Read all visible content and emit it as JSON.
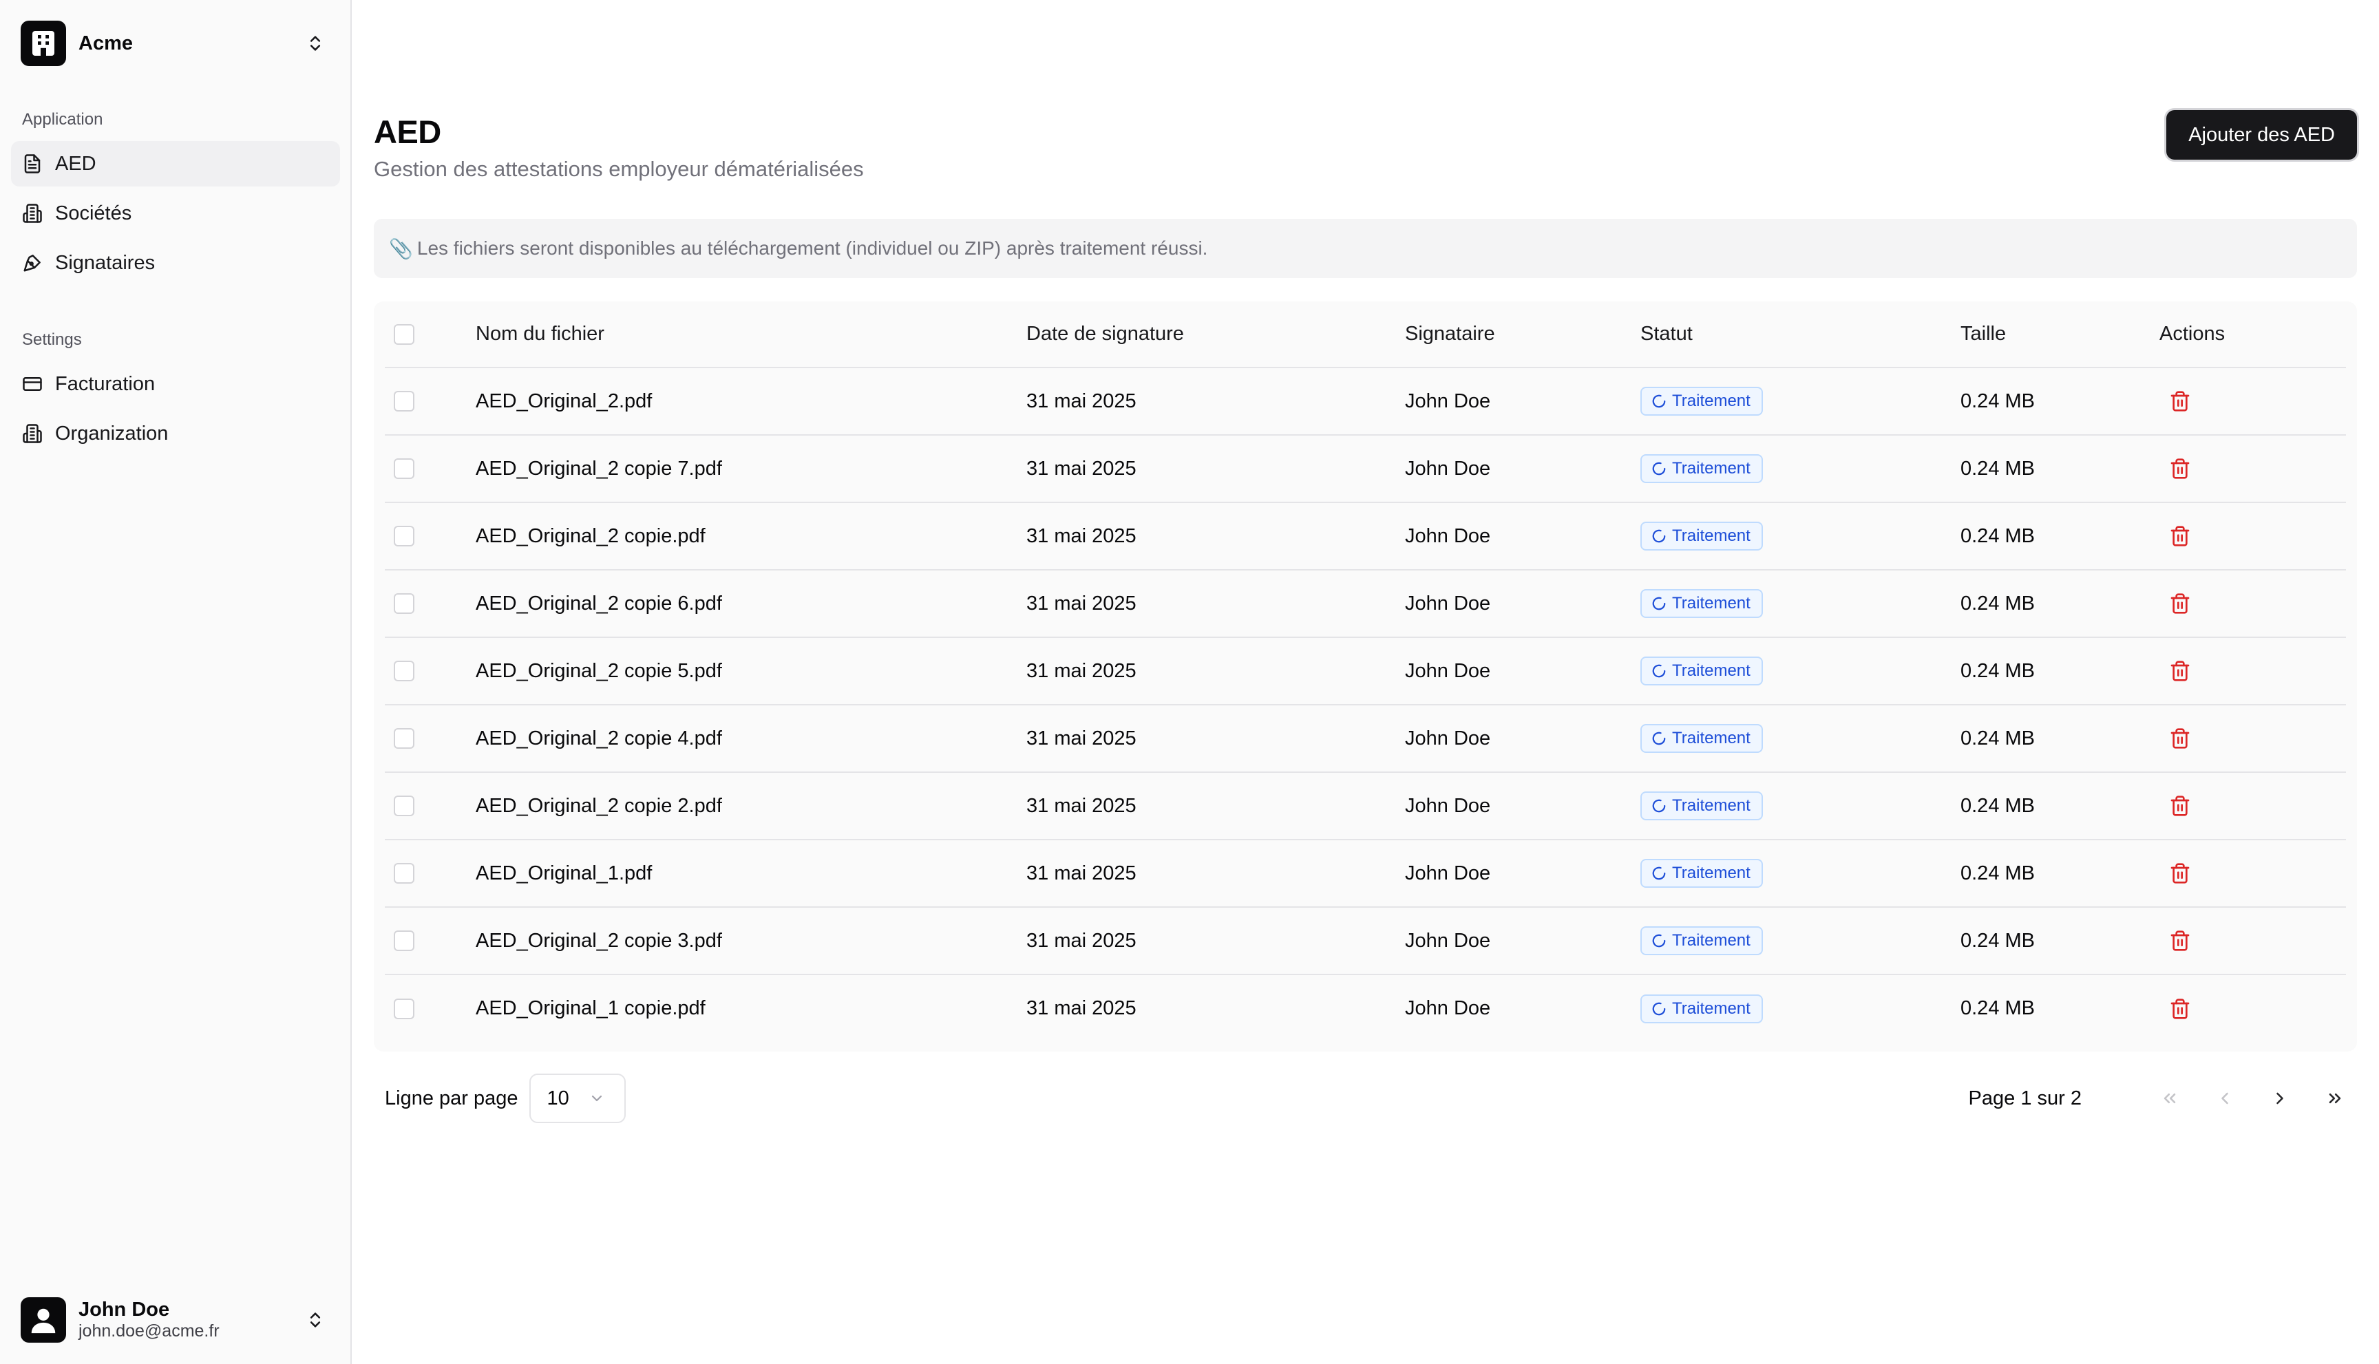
{
  "team": {
    "name": "Acme"
  },
  "sidebar": {
    "groups": [
      {
        "label": "Application",
        "items": [
          {
            "label": "AED",
            "icon": "file-text-icon",
            "active": true
          },
          {
            "label": "Sociétés",
            "icon": "building-icon"
          },
          {
            "label": "Signataires",
            "icon": "signature-icon"
          }
        ]
      },
      {
        "label": "Settings",
        "items": [
          {
            "label": "Facturation",
            "icon": "credit-card-icon"
          },
          {
            "label": "Organization",
            "icon": "building-icon"
          }
        ]
      }
    ]
  },
  "user": {
    "name": "John Doe",
    "email": "john.doe@acme.fr"
  },
  "page": {
    "title": "AED",
    "subtitle": "Gestion des attestations employeur dématérialisées",
    "primary_action": "Ajouter des AED",
    "info": "Les fichiers seront disponibles au téléchargement (individuel ou ZIP) après traitement réussi."
  },
  "table": {
    "headers": {
      "name": "Nom du fichier",
      "date": "Date de signature",
      "signer": "Signataire",
      "status": "Statut",
      "size": "Taille",
      "actions": "Actions"
    },
    "rows": [
      {
        "name": "AED_Original_2.pdf",
        "date": "31 mai 2025",
        "signer": "John Doe",
        "status": "Traitement",
        "size": "0.24 MB"
      },
      {
        "name": "AED_Original_2 copie 7.pdf",
        "date": "31 mai 2025",
        "signer": "John Doe",
        "status": "Traitement",
        "size": "0.24 MB"
      },
      {
        "name": "AED_Original_2 copie.pdf",
        "date": "31 mai 2025",
        "signer": "John Doe",
        "status": "Traitement",
        "size": "0.24 MB"
      },
      {
        "name": "AED_Original_2 copie 6.pdf",
        "date": "31 mai 2025",
        "signer": "John Doe",
        "status": "Traitement",
        "size": "0.24 MB"
      },
      {
        "name": "AED_Original_2 copie 5.pdf",
        "date": "31 mai 2025",
        "signer": "John Doe",
        "status": "Traitement",
        "size": "0.24 MB"
      },
      {
        "name": "AED_Original_2 copie 4.pdf",
        "date": "31 mai 2025",
        "signer": "John Doe",
        "status": "Traitement",
        "size": "0.24 MB"
      },
      {
        "name": "AED_Original_2 copie 2.pdf",
        "date": "31 mai 2025",
        "signer": "John Doe",
        "status": "Traitement",
        "size": "0.24 MB"
      },
      {
        "name": "AED_Original_1.pdf",
        "date": "31 mai 2025",
        "signer": "John Doe",
        "status": "Traitement",
        "size": "0.24 MB"
      },
      {
        "name": "AED_Original_2 copie 3.pdf",
        "date": "31 mai 2025",
        "signer": "John Doe",
        "status": "Traitement",
        "size": "0.24 MB"
      },
      {
        "name": "AED_Original_1 copie.pdf",
        "date": "31 mai 2025",
        "signer": "John Doe",
        "status": "Traitement",
        "size": "0.24 MB"
      }
    ]
  },
  "pagination": {
    "rows_label": "Ligne par page",
    "rows_value": "10",
    "page_info": "Page 1 sur 2"
  },
  "colors": {
    "accent": "#18181b",
    "status_blue": "#1d4ed8",
    "danger": "#dc2626"
  }
}
